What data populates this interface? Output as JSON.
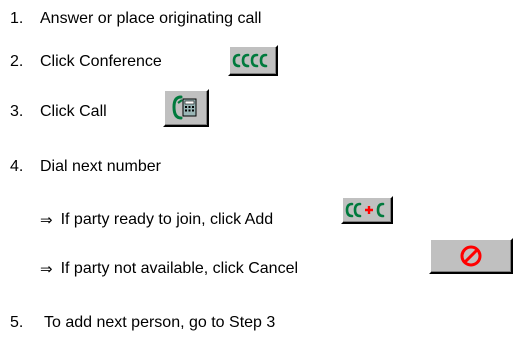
{
  "steps": [
    {
      "num": "1.",
      "text": "Answer or place originating call"
    },
    {
      "num": "2.",
      "text": "Click Conference",
      "icon": "conference-icon"
    },
    {
      "num": "3.",
      "text": "Click Call",
      "icon": "call-icon"
    },
    {
      "num": "4.",
      "text": "Dial next number"
    },
    {
      "num": "5.",
      "text": "To add next person, go to Step 3"
    }
  ],
  "substeps": [
    {
      "bullet": "⇒",
      "text": "If party ready to join, click Add",
      "icon": "add-party-icon"
    },
    {
      "bullet": "⇒",
      "text": "If party not available, click Cancel",
      "icon": "cancel-icon"
    }
  ],
  "colors": {
    "button_face": "#c0c0c0",
    "icon_green": "#007a3d",
    "icon_red": "#ff0000"
  }
}
